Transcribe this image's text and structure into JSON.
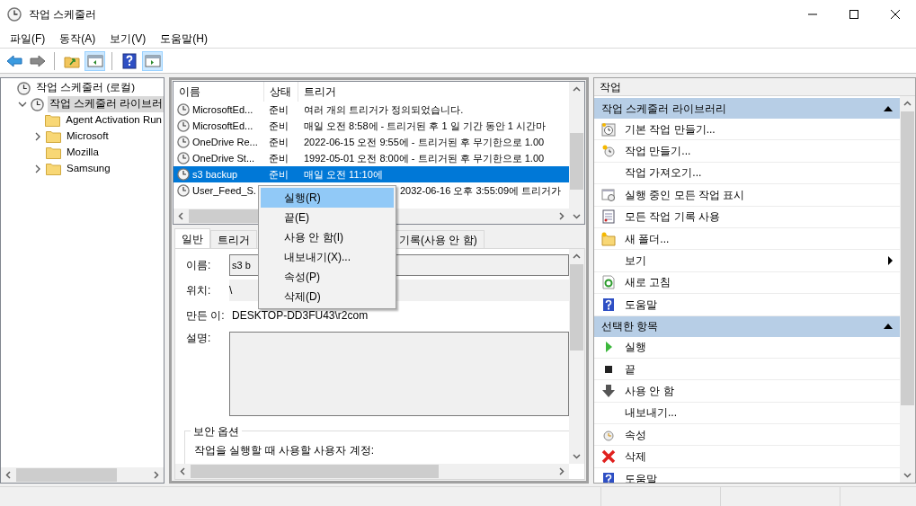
{
  "window": {
    "title": "작업 스케줄러"
  },
  "menu": [
    "파일(F)",
    "동작(A)",
    "보기(V)",
    "도움말(H)"
  ],
  "toolbar": [
    {
      "kind": "back",
      "pressed": false
    },
    {
      "kind": "forward",
      "pressed": false
    },
    {
      "kind": "sep"
    },
    {
      "kind": "up",
      "pressed": false
    },
    {
      "kind": "tree",
      "pressed": true
    },
    {
      "kind": "sep"
    },
    {
      "kind": "help",
      "pressed": false
    },
    {
      "kind": "pane",
      "pressed": true
    }
  ],
  "tree": {
    "label": "작업 스케줄러 (로컬)",
    "children": [
      {
        "label": "작업 스케줄러 라이브러",
        "expanded": true,
        "selected": true,
        "children": [
          {
            "label": "Agent Activation Run",
            "selected": false
          },
          {
            "label": "Microsoft",
            "expanded": false,
            "selected": false
          },
          {
            "label": "Mozilla",
            "selected": false
          },
          {
            "label": "Samsung",
            "expanded": false,
            "selected": false
          }
        ]
      }
    ]
  },
  "task_list": {
    "columns": [
      "이름",
      "상태",
      "트리거"
    ],
    "rows": [
      {
        "name": "MicrosoftEd...",
        "status": "준비",
        "trigger": "여러 개의 트리거가 정의되었습니다.",
        "selected": false
      },
      {
        "name": "MicrosoftEd...",
        "status": "준비",
        "trigger": "매일 오전 8:58에 - 트리거된 후 1 일 기간 동안 1 시간마",
        "selected": false
      },
      {
        "name": "OneDrive Re...",
        "status": "준비",
        "trigger": "2022-06-15 오전 9:55에 - 트리거된 후 무기한으로 1.00",
        "selected": false
      },
      {
        "name": "OneDrive St...",
        "status": "준비",
        "trigger": "1992-05-01 오전 8:00에 - 트리거된 후 무기한으로 1.00",
        "selected": false
      },
      {
        "name": "s3 backup",
        "status": "준비",
        "trigger": "매일 오전 11:10에",
        "selected": true
      },
      {
        "name": "User_Feed_S.",
        "trigger": "2032-06-16 오후 3:55:09에 트리거가",
        "selected": false
      }
    ]
  },
  "detail": {
    "tabs": [
      {
        "label": "일반",
        "selected": true
      },
      {
        "label": "트리거",
        "selected": false
      },
      {
        "label": "기록(사용 안 함)",
        "selected": false
      }
    ],
    "fields": [
      {
        "kind": "input",
        "label": "이름:",
        "value": "s3 b"
      },
      {
        "kind": "readonly",
        "label": "위치:",
        "value": "\\"
      },
      {
        "kind": "text",
        "label": "만든 이:",
        "value": "DESKTOP-DD3FU43\\r2com"
      },
      {
        "kind": "textarea",
        "label": "설명:"
      }
    ],
    "security": {
      "title": "보안 옵션",
      "text": "작업을 실행할 때 사용할 사용자 계정:"
    }
  },
  "actions": {
    "title": "작업",
    "sections": [
      {
        "title": "작업 스케줄러 라이브러리",
        "expanded": true,
        "items": [
          {
            "label": "기본 작업 만들기...",
            "submenu": false
          },
          {
            "label": "작업 만들기...",
            "submenu": false
          },
          {
            "label": "작업 가져오기...",
            "submenu": false
          },
          {
            "label": "실행 중인 모든 작업 표시",
            "submenu": false
          },
          {
            "label": "모든 작업 기록 사용",
            "submenu": false
          },
          {
            "label": "새 폴더...",
            "submenu": false
          },
          {
            "label": "보기",
            "submenu": true
          },
          {
            "label": "새로 고침",
            "submenu": false
          },
          {
            "label": "도움말",
            "submenu": false
          }
        ]
      },
      {
        "title": "선택한 항목",
        "expanded": true,
        "items": [
          {
            "label": "실행",
            "submenu": false
          },
          {
            "label": "끝",
            "submenu": false
          },
          {
            "label": "사용 안 함",
            "submenu": false
          },
          {
            "label": "내보내기...",
            "submenu": false
          },
          {
            "label": "속성",
            "submenu": false
          },
          {
            "label": "삭제",
            "submenu": false
          },
          {
            "label": "도움말",
            "submenu": false
          }
        ]
      }
    ]
  },
  "context_menu": {
    "items": [
      {
        "label": "실행(R)",
        "selected": true
      },
      {
        "label": "끝(E)",
        "selected": false
      },
      {
        "label": "사용 안 함(I)",
        "selected": false
      },
      {
        "label": "내보내기(X)...",
        "selected": false
      },
      {
        "label": "속성(P)",
        "selected": false
      },
      {
        "label": "삭제(D)",
        "selected": false
      }
    ]
  }
}
